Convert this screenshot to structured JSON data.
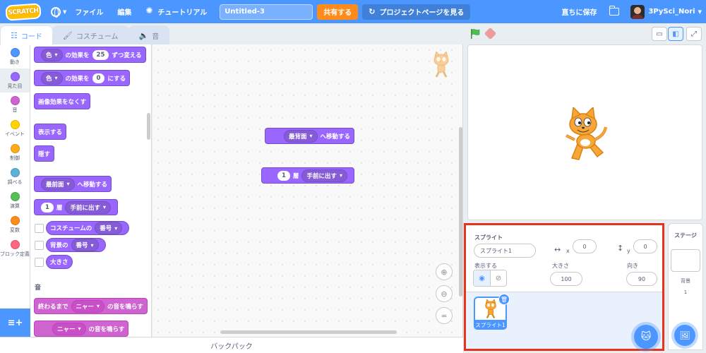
{
  "menubar": {
    "logo": "SCRATCH",
    "file": "ファイル",
    "edit": "編集",
    "tutorials": "チュートリアル",
    "project_title": "Untitled-3",
    "share": "共有する",
    "project_page": "プロジェクトページを見る",
    "save_now": "直ちに保存",
    "username": "3PySci_Nori"
  },
  "tabs": [
    {
      "label": "コード",
      "icon": "code-icon"
    },
    {
      "label": "コスチューム",
      "icon": "brush-icon"
    },
    {
      "label": "音",
      "icon": "speaker-icon"
    }
  ],
  "categories": [
    {
      "label": "動き",
      "color": "#4c97ff"
    },
    {
      "label": "見た目",
      "color": "#9966ff"
    },
    {
      "label": "音",
      "color": "#cf63cf"
    },
    {
      "label": "イベント",
      "color": "#ffd500"
    },
    {
      "label": "制御",
      "color": "#ffab19"
    },
    {
      "label": "調べる",
      "color": "#5cb1d6"
    },
    {
      "label": "演算",
      "color": "#59c059"
    },
    {
      "label": "変数",
      "color": "#ff8c1a"
    },
    {
      "label": "ブロック定義",
      "color": "#ff6680"
    }
  ],
  "palette": {
    "b1": {
      "a": "色",
      "b": "の効果を",
      "num": "25",
      "c": "ずつ変える"
    },
    "b2": {
      "a": "色",
      "b": "の効果を",
      "num": "0",
      "c": "にする"
    },
    "b3": "画像効果をなくす",
    "b4": "表示する",
    "b5": "隠す",
    "b6": {
      "a": "最前面",
      "b": "へ移動する"
    },
    "b7": {
      "num": "1",
      "a": "層",
      "b": "手前に出す"
    },
    "r1": {
      "a": "コスチュームの",
      "b": "番号"
    },
    "r2": {
      "a": "背景の",
      "b": "番号"
    },
    "r3": "大きさ",
    "sound_heading": "音",
    "s1": {
      "a": "終わるまで",
      "b": "ニャー",
      "c": "の音を鳴らす"
    },
    "s2": {
      "b": "ニャー",
      "c": "の音を鳴らす"
    }
  },
  "workspace": {
    "w1": {
      "a": "最背面",
      "b": "へ移動する"
    },
    "w2": {
      "num": "1",
      "a": "層",
      "b": "手前に出す"
    }
  },
  "backpack": "バックパック",
  "sprite_info": {
    "label_sprite": "スプライト",
    "sprite_name": "スプライト1",
    "x_label": "x",
    "x_value": "0",
    "y_label": "y",
    "y_value": "0",
    "show_label": "表示する",
    "size_label": "大きさ",
    "size_value": "100",
    "direction_label": "向き",
    "direction_value": "90"
  },
  "sprite_list": [
    {
      "name": "スプライト1"
    }
  ],
  "stage_target": {
    "title": "ステージ",
    "backdrop_label": "背景",
    "backdrop_count": "1"
  },
  "colors": {
    "menubar": "#4c97ff",
    "looks": "#9966ff",
    "sound": "#cf63cf",
    "share": "#ff8c1a",
    "highlight": "#e8321b"
  }
}
